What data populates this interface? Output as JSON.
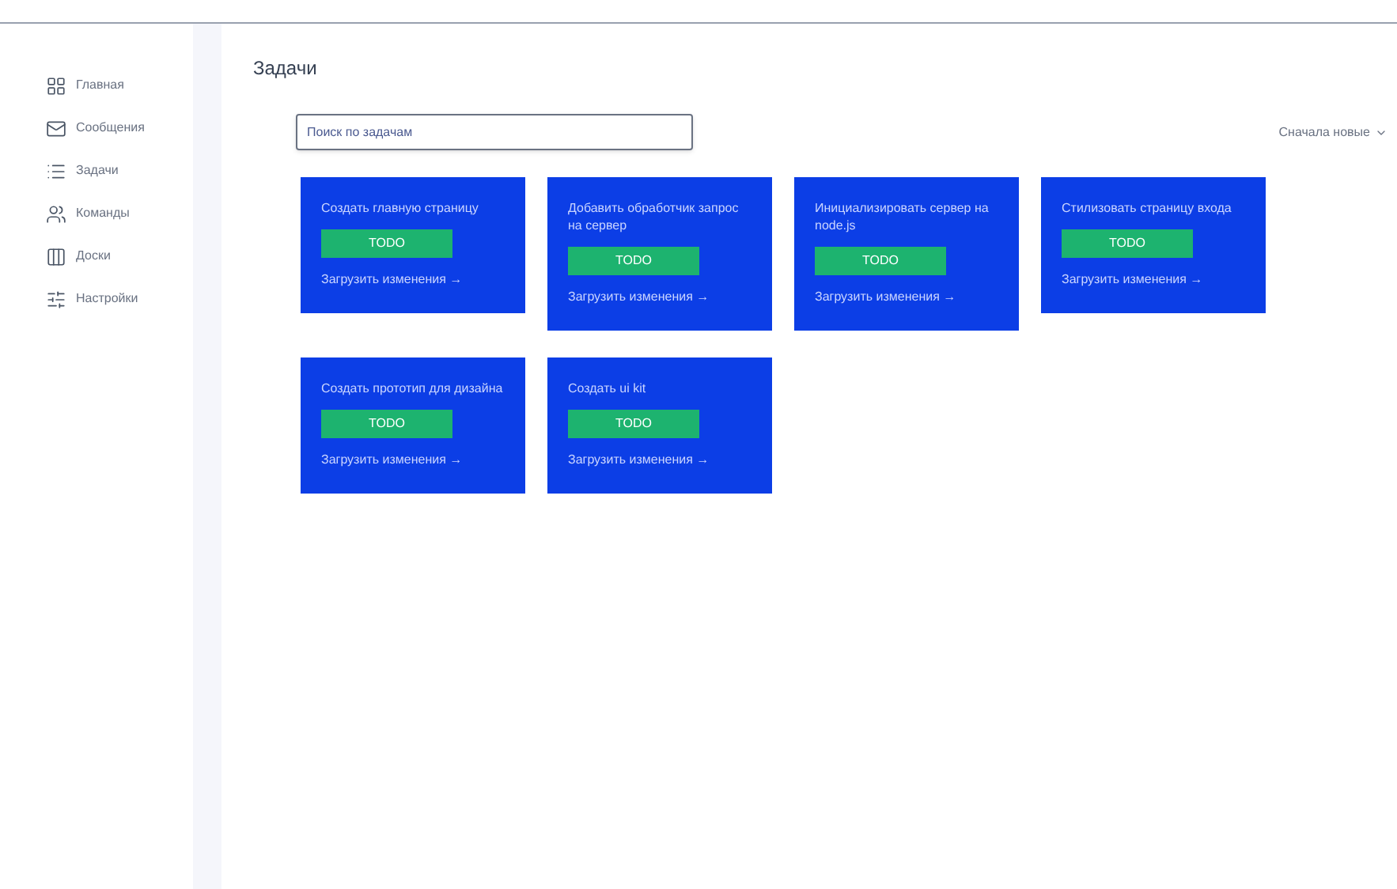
{
  "sidebar": {
    "items": [
      {
        "label": "Главная"
      },
      {
        "label": "Сообщения"
      },
      {
        "label": "Задачи"
      },
      {
        "label": "Команды"
      },
      {
        "label": "Доски"
      },
      {
        "label": "Настройки"
      }
    ]
  },
  "title": "Задачи",
  "search": {
    "placeholder": "Поиск по задачам"
  },
  "sort": {
    "label": "Сначала новые"
  },
  "tasks": [
    {
      "title": "Создать главную страницу",
      "status": "TODO",
      "link": "Загрузить изменения →"
    },
    {
      "title": "Добавить обработчик запрос на сервер",
      "status": "TODO",
      "link": "Загрузить изменения →"
    },
    {
      "title": "Инициализировать сервер на node.js",
      "status": "TODO",
      "link": "Загрузить изменения →"
    },
    {
      "title": "Стилизовать страницу входа",
      "status": "TODO",
      "link": "Загрузить изменения →"
    },
    {
      "title": "Создать прототип для дизайна",
      "status": "TODO",
      "link": "Загрузить изменения →"
    },
    {
      "title": "Создать ui kit",
      "status": "TODO",
      "link": "Загрузить изменения →"
    }
  ]
}
